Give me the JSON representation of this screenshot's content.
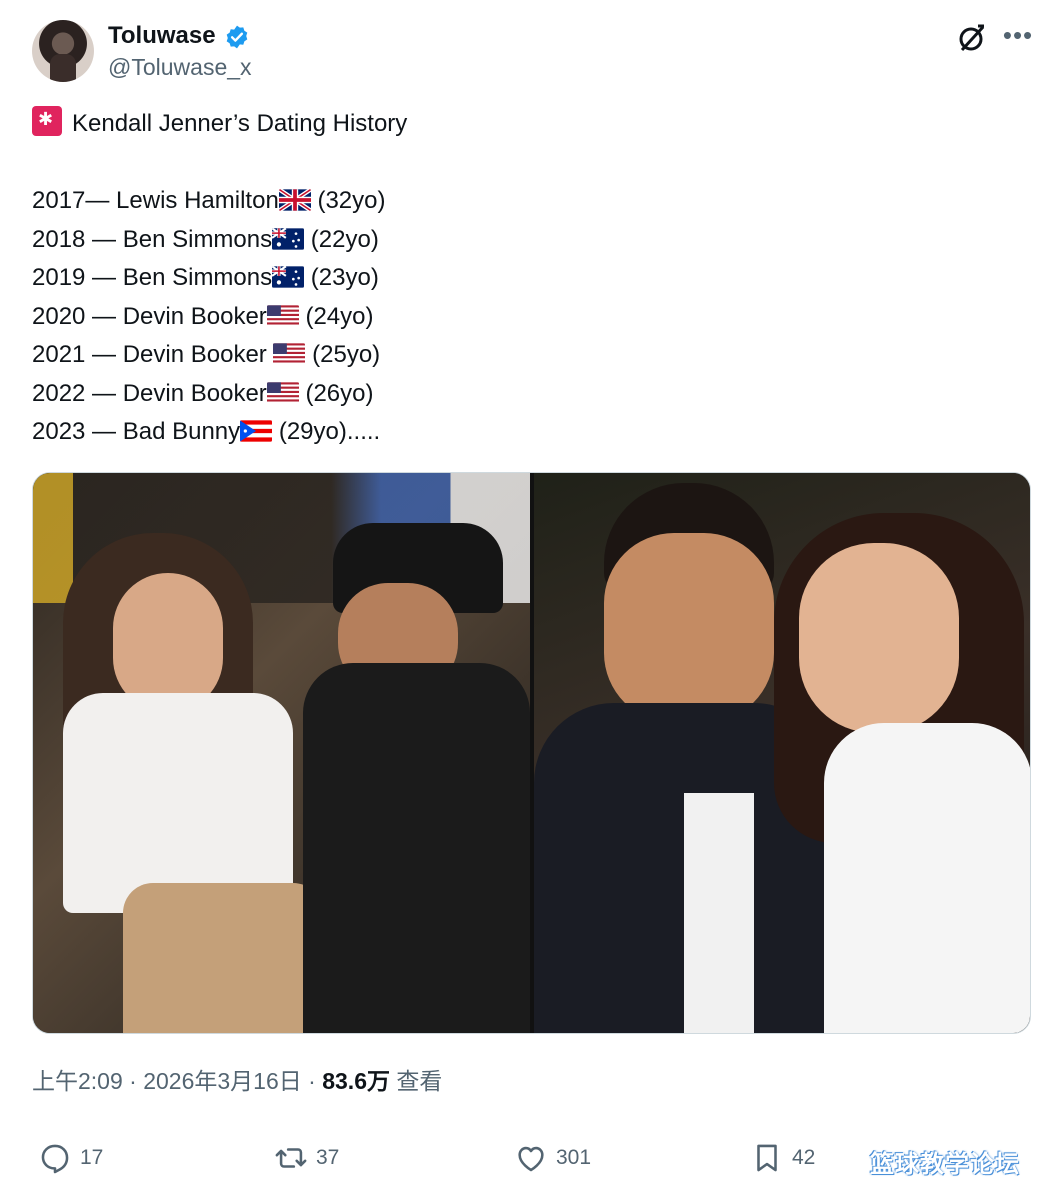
{
  "author": {
    "name": "Toluwase",
    "handle": "@Toluwase_x"
  },
  "icons": {
    "verified": "verified-badge-icon",
    "grok": "grok-icon",
    "more": "more-icon",
    "siren": "rotating-light-icon"
  },
  "tweet": {
    "title": "Kendall Jenner’s Dating History",
    "lines": [
      {
        "text_before": "2017— Lewis Hamilton",
        "flag": "uk",
        "text_after": " (32yo)"
      },
      {
        "text_before": "2018 — Ben Simmons",
        "flag": "au",
        "text_after": " (22yo)"
      },
      {
        "text_before": "2019 — Ben Simmons",
        "flag": "au",
        "text_after": " (23yo)"
      },
      {
        "text_before": "2020 — Devin Booker",
        "flag": "us",
        "text_after": " (24yo)"
      },
      {
        "text_before": "2021 — Devin Booker ",
        "flag": "us",
        "text_after": " (25yo)"
      },
      {
        "text_before": "2022 — Devin Booker",
        "flag": "us",
        "text_after": " (26yo)"
      },
      {
        "text_before": "2023 — Bad Bunny",
        "flag": "pr",
        "text_after": " (29yo)....."
      }
    ]
  },
  "meta": {
    "time": "上午2:09",
    "sep1": " · ",
    "date": "2026年3月16日",
    "sep2": " · ",
    "views": "83.6万",
    "views_label": " 查看"
  },
  "actions": {
    "replies": "17",
    "reposts": "37",
    "likes": "301",
    "bookmarks": "42"
  },
  "watermark": "篮球教学论坛",
  "colors": {
    "text": "#0f1419",
    "secondary": "#536471",
    "verified": "#1d9bf0"
  }
}
